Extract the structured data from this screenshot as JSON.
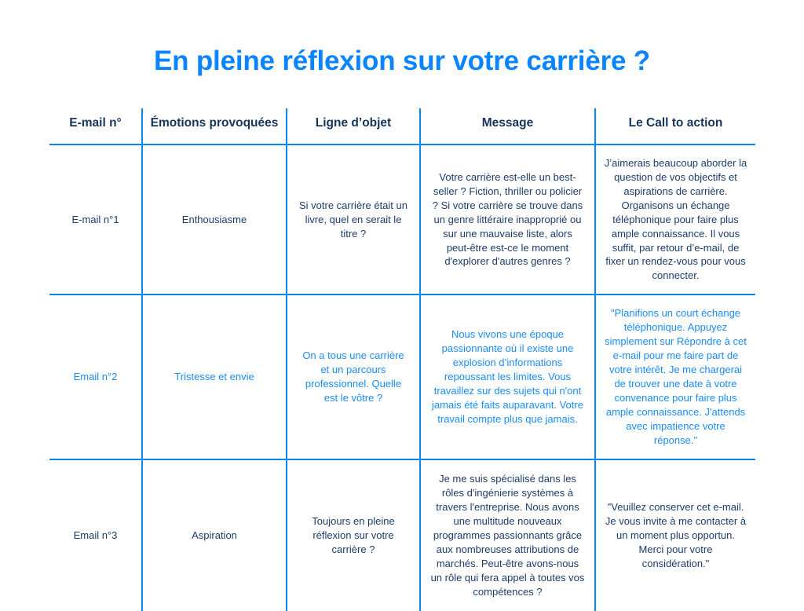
{
  "page": {
    "title": "En pleine réflexion sur votre carrière ?",
    "accent_blue": "#0a84ff",
    "border_blue": "#0a86f0",
    "header_text_color": "#15355e",
    "body_text_color": "#1c3d6b",
    "accent_row_text_color": "#1a8cf5",
    "background": "#ffffff"
  },
  "table": {
    "headers": [
      "E-mail n°",
      "Émotions provoquées",
      "Ligne d’objet",
      "Message",
      "Le Call to action"
    ],
    "rows": [
      {
        "style": "normal",
        "email_number": "E-mail n°1",
        "emotion": "Enthousiasme",
        "subject": "Si votre carrière était un livre, quel en serait le titre ?",
        "message": "Votre carrière est-elle un best-seller ? Fiction, thriller ou policier ? Si votre carrière se trouve dans un genre littéraire inapproprié ou sur une mauvaise liste, alors peut-être est-ce le moment d'explorer d'autres genres ?",
        "cta": "J’aimerais beaucoup aborder la question de vos objectifs et aspirations de carrière. Organisons un échange téléphonique pour faire plus ample connaissance. Il vous suffit, par retour d’e-mail, de fixer un rendez-vous pour vous connecter."
      },
      {
        "style": "accent",
        "email_number": "Email n°2",
        "emotion": "Tristesse et envie",
        "subject": "On a tous une carrière et un parcours professionnel. Quelle est le vôtre ?",
        "message": "Nous vivons une époque passionnante où il existe une explosion d’informations repoussant les limites. Vous travaillez sur des sujets qui n'ont jamais été faits auparavant. Votre travail compte plus que jamais.",
        "cta": "\"Planifions un court échange téléphonique. Appuyez simplement sur Répondre à cet e-mail pour me faire part de votre intérêt. Je me chargerai de trouver une date à votre convenance pour faire plus ample connaissance. J'attends avec impatience votre réponse.\""
      },
      {
        "style": "normal",
        "email_number": "Email n°3",
        "emotion": "Aspiration",
        "subject": "Toujours en pleine réflexion sur votre carrière ?",
        "message": "Je me suis spécialisé dans les rôles d'ingénierie systèmes à travers l'entreprise. Nous avons une multitude nouveaux programmes passionnants grâce aux nombreuses attributions de marchés. Peut-être avons-nous un rôle qui fera appel à toutes vos compétences ?",
        "cta": "\"Veuillez conserver cet e-mail. Je vous invite à me contacter à un moment plus opportun. Merci pour votre considération.\""
      }
    ]
  }
}
